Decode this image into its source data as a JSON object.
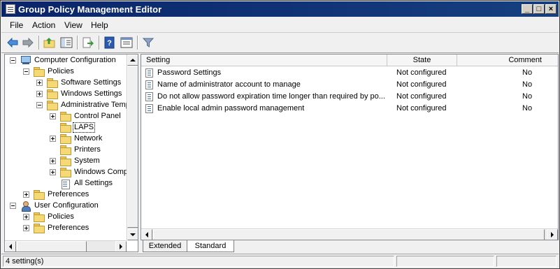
{
  "window": {
    "title": "Group Policy Management Editor",
    "buttons": {
      "minimize": "_",
      "maximize": "□",
      "close": "×"
    }
  },
  "menubar": {
    "items": [
      "File",
      "Action",
      "View",
      "Help"
    ]
  },
  "toolbar": {
    "icons": [
      "back-arrow-icon",
      "forward-arrow-icon",
      "up-folder-icon",
      "show-hide-tree-icon",
      "export-list-icon",
      "help-icon",
      "properties-icon",
      "filter-icon"
    ]
  },
  "tree": {
    "items": [
      {
        "label": "Computer Configuration",
        "icon": "computer-icon",
        "expander": "minus"
      },
      {
        "label": "Policies",
        "icon": "folder-icon",
        "expander": "minus"
      },
      {
        "label": "Software Settings",
        "icon": "folder-icon",
        "expander": "plus"
      },
      {
        "label": "Windows Settings",
        "icon": "folder-icon",
        "expander": "plus"
      },
      {
        "label": "Administrative Temp",
        "icon": "folder-icon",
        "expander": "minus"
      },
      {
        "label": "Control Panel",
        "icon": "folder-icon",
        "expander": "plus"
      },
      {
        "label": "LAPS",
        "icon": "folder-icon",
        "expander": "none",
        "selected": true
      },
      {
        "label": "Network",
        "icon": "folder-icon",
        "expander": "plus"
      },
      {
        "label": "Printers",
        "icon": "folder-icon",
        "expander": "none"
      },
      {
        "label": "System",
        "icon": "folder-icon",
        "expander": "plus"
      },
      {
        "label": "Windows Compo",
        "icon": "folder-icon",
        "expander": "plus"
      },
      {
        "label": "All Settings",
        "icon": "all-settings-icon",
        "expander": "none"
      },
      {
        "label": "Preferences",
        "icon": "folder-icon",
        "expander": "plus"
      },
      {
        "label": "User Configuration",
        "icon": "user-icon",
        "expander": "minus"
      },
      {
        "label": "Policies",
        "icon": "folder-icon",
        "expander": "plus"
      },
      {
        "label": "Preferences",
        "icon": "folder-icon",
        "expander": "plus"
      }
    ]
  },
  "list": {
    "columns": [
      "Setting",
      "State",
      "Comment"
    ],
    "rows": [
      {
        "setting": "Password Settings",
        "state": "Not configured",
        "comment": "No"
      },
      {
        "setting": "Name of administrator account to manage",
        "state": "Not configured",
        "comment": "No"
      },
      {
        "setting": "Do not allow password expiration time longer than required by po...",
        "state": "Not configured",
        "comment": "No"
      },
      {
        "setting": "Enable local admin password management",
        "state": "Not configured",
        "comment": "No"
      }
    ]
  },
  "tabs": [
    "Extended",
    "Standard"
  ],
  "status": {
    "text": "4 setting(s)"
  },
  "colors": {
    "titlebar": "#0a246a",
    "selection_border": "#000000",
    "folder": "#f4d977"
  }
}
